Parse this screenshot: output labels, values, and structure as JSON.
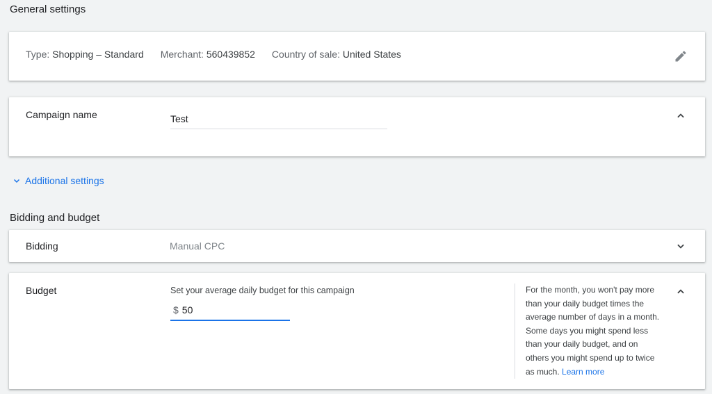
{
  "general_settings": {
    "title": "General settings",
    "type_label": "Type:",
    "type_value": "Shopping – Standard",
    "merchant_label": "Merchant:",
    "merchant_value": "560439852",
    "country_label": "Country of sale:",
    "country_value": "United States"
  },
  "campaign_name": {
    "label": "Campaign name",
    "value": "Test"
  },
  "additional_settings": {
    "label": "Additional settings"
  },
  "bidding_budget": {
    "title": "Bidding and budget",
    "bidding_label": "Bidding",
    "bidding_value": "Manual CPC",
    "budget_label": "Budget",
    "budget_hint": "Set your average daily budget for this campaign",
    "currency": "$",
    "budget_value": "50",
    "help_text": "For the month, you won't pay more than your daily budget times the average number of days in a month. Some days you might spend less than your daily budget, and on others you might spend up to twice as much.",
    "learn_more": "Learn more"
  },
  "colors": {
    "accent": "#1a73e8",
    "background": "#f1f3f4",
    "card": "#ffffff"
  },
  "icons": {
    "edit": "pencil-icon",
    "collapse": "chevron-up-icon",
    "expand": "chevron-down-icon"
  }
}
